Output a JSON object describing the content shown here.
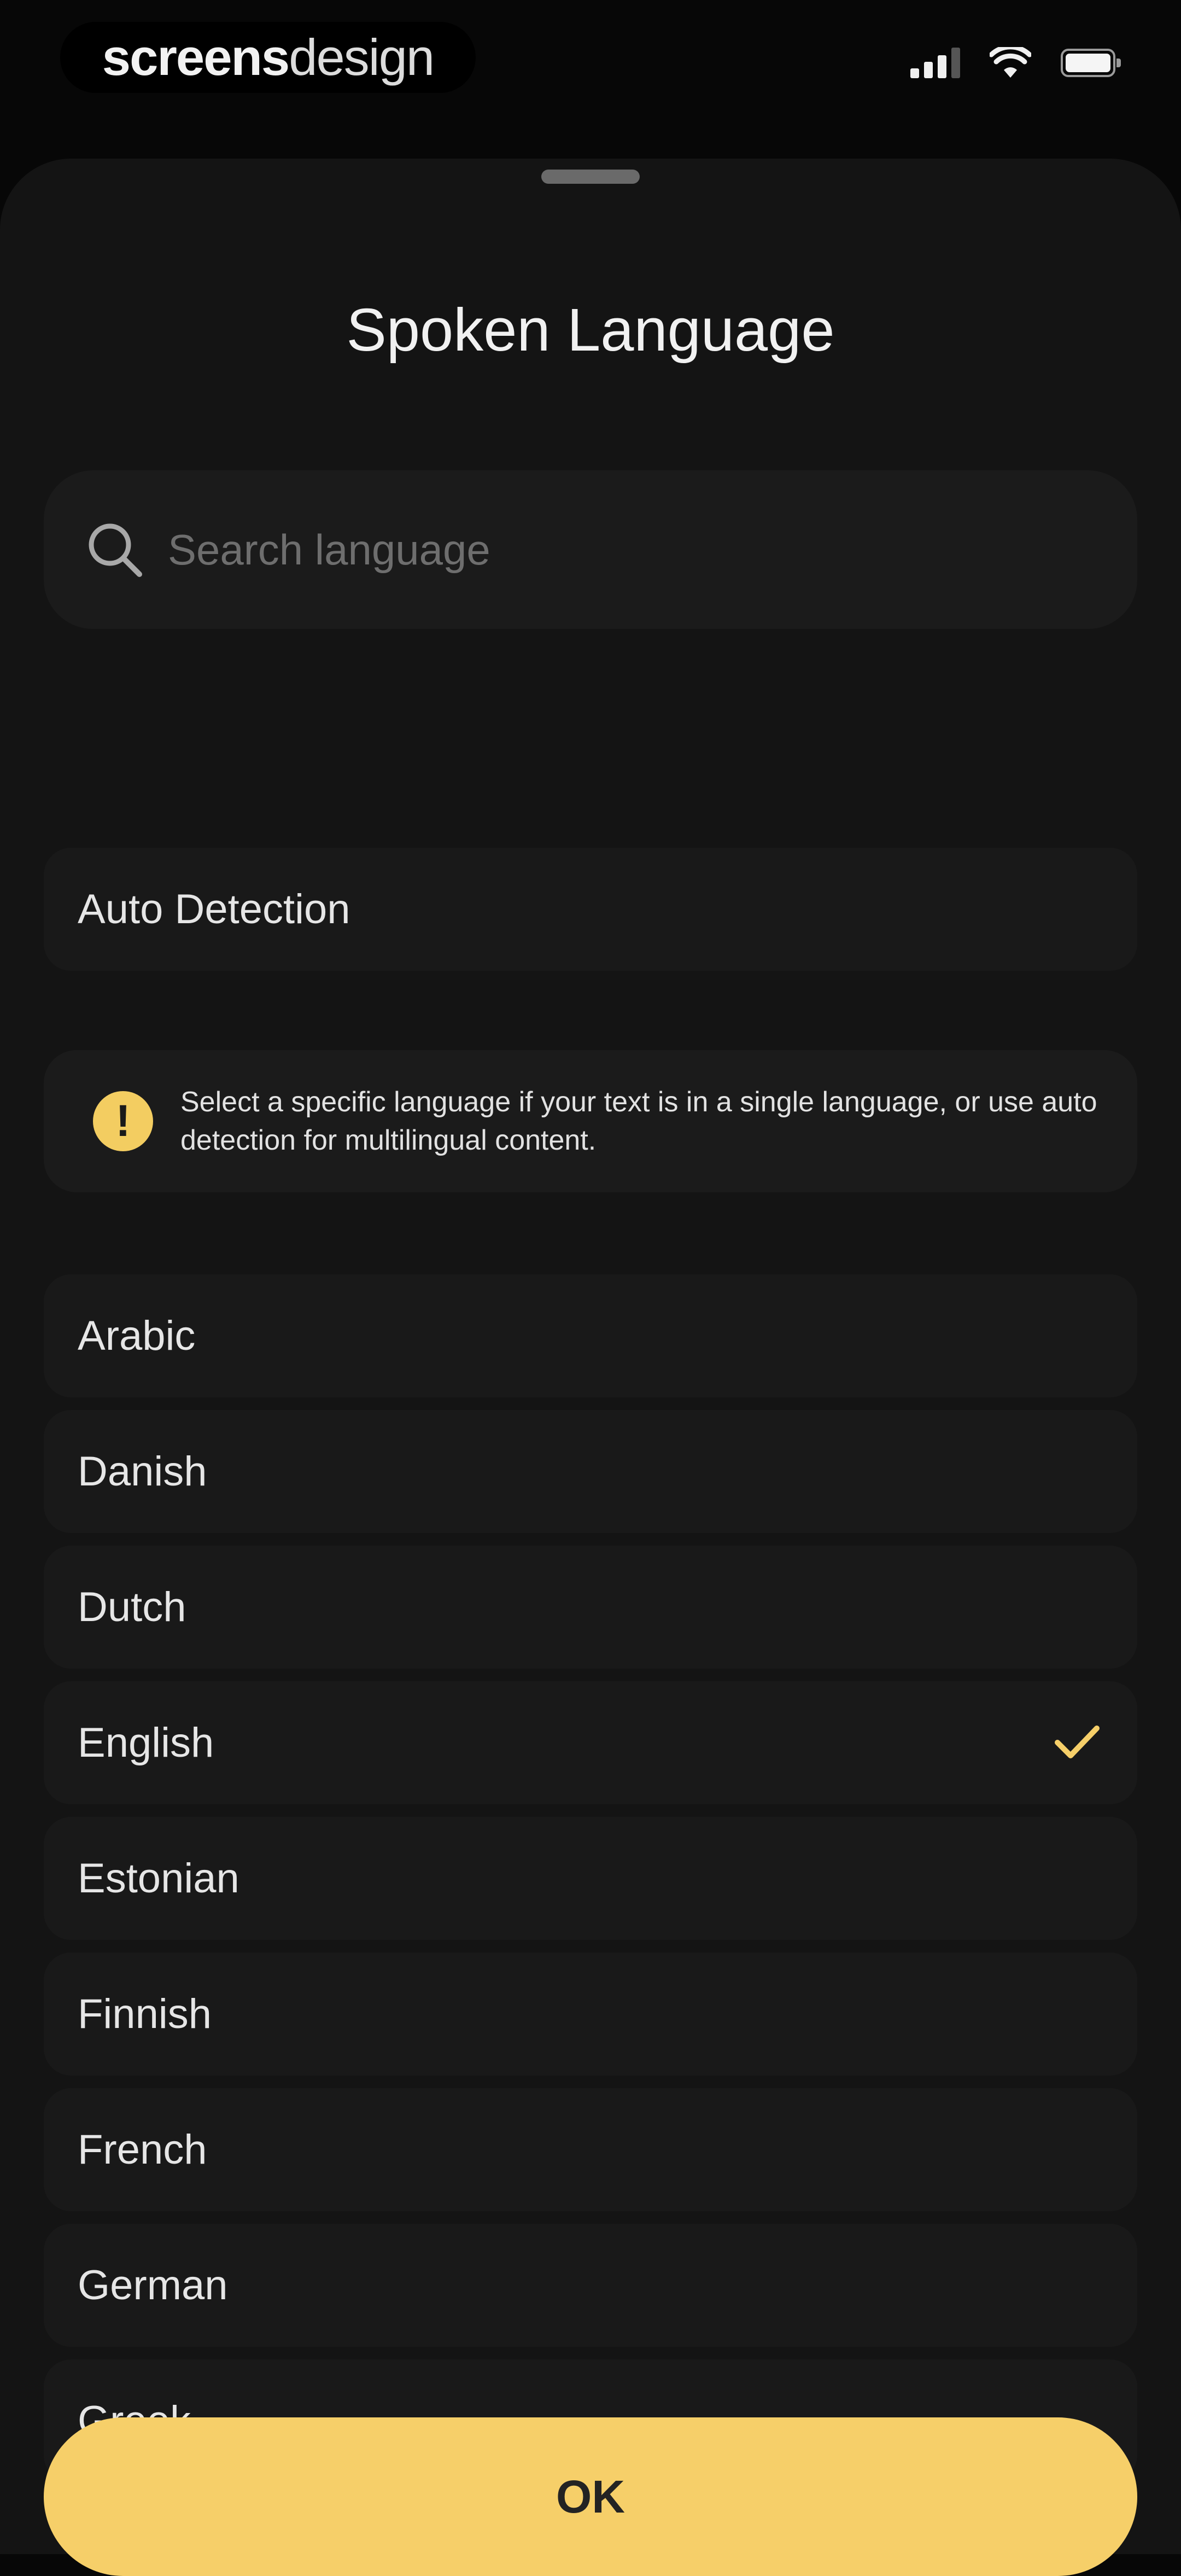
{
  "status_bar": {
    "brand_bold": "screens",
    "brand_light": "design"
  },
  "sheet": {
    "title": "Spoken Language"
  },
  "search": {
    "placeholder": "Search language"
  },
  "auto_detection": {
    "label": "Auto Detection"
  },
  "info": {
    "icon_glyph": "!",
    "text": "Select a specific language if your text is in a single language, or use auto detection for multilingual content."
  },
  "languages": [
    {
      "label": "Arabic",
      "selected": false
    },
    {
      "label": "Danish",
      "selected": false
    },
    {
      "label": "Dutch",
      "selected": false
    },
    {
      "label": "English",
      "selected": true
    },
    {
      "label": "Estonian",
      "selected": false
    },
    {
      "label": "Finnish",
      "selected": false
    },
    {
      "label": "French",
      "selected": false
    },
    {
      "label": "German",
      "selected": false
    },
    {
      "label": "Greek",
      "selected": false
    }
  ],
  "ok_button": {
    "label": "OK"
  },
  "colors": {
    "accent": "#f6cf69",
    "sheet_bg": "#141414",
    "row_bg": "#191919"
  }
}
